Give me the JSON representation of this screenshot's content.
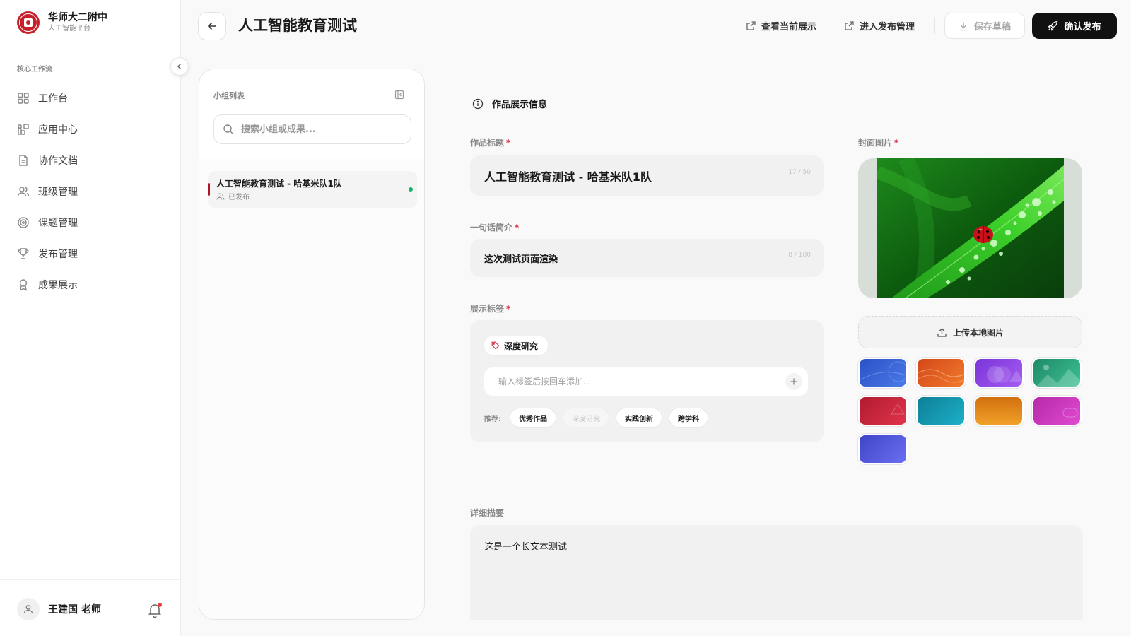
{
  "brand": {
    "title": "华师大二附中",
    "subtitle": "人工智能平台"
  },
  "sidebar": {
    "section_label": "核心工作流",
    "items": [
      {
        "label": "工作台",
        "icon": "dashboard-icon"
      },
      {
        "label": "应用中心",
        "icon": "apps-icon"
      },
      {
        "label": "协作文档",
        "icon": "document-icon"
      },
      {
        "label": "班级管理",
        "icon": "users-icon"
      },
      {
        "label": "课题管理",
        "icon": "target-icon"
      },
      {
        "label": "发布管理",
        "icon": "trophy-icon"
      },
      {
        "label": "成果展示",
        "icon": "award-icon"
      }
    ],
    "user_name": "王建国 老师"
  },
  "header": {
    "title": "人工智能教育测试",
    "view_current": "查看当前展示",
    "publish_manage": "进入发布管理",
    "save_draft": "保存草稿",
    "confirm_publish": "确认发布"
  },
  "groups": {
    "title": "小组列表",
    "search_placeholder": "搜索小组或成果...",
    "items": [
      {
        "title": "人工智能教育测试 - 哈基米队1队",
        "status": "已发布",
        "status_color": "#15b36a"
      }
    ]
  },
  "form": {
    "section_title": "作品展示信息",
    "title_label": "作品标题",
    "title_value": "人工智能教育测试 - 哈基米队1队",
    "title_counter": "17 / 50",
    "intro_label": "一句话简介",
    "intro_value": "这次测试页面渲染",
    "intro_counter": "8 / 100",
    "tags_label": "展示标签",
    "tags": [
      "深度研究"
    ],
    "tag_input_placeholder": "输入标签后按回车添加...",
    "recommend_label": "推荐:",
    "recommended": [
      {
        "label": "优秀作品",
        "disabled": false
      },
      {
        "label": "深度研究",
        "disabled": true
      },
      {
        "label": "实践创新",
        "disabled": false
      },
      {
        "label": "跨学科",
        "disabled": false
      }
    ],
    "cover_label": "封面图片",
    "upload_label": "上传本地图片",
    "summary_label": "详细描要",
    "summary_value": "这是一个长文本测试",
    "required_mark": "*"
  },
  "colors": {
    "accent": "#111111",
    "required": "#d7263d",
    "brand": "#c8202a",
    "swatches": [
      "#2f5fd0",
      "#e5581f",
      "#8a3ee0",
      "#2aa57c",
      "#c8213a",
      "#138fa8",
      "#e08a1a",
      "#c837b8",
      "#5055d8"
    ]
  }
}
